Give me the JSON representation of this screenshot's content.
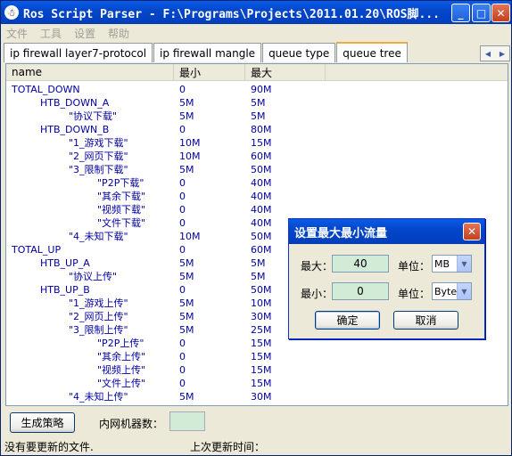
{
  "window": {
    "title": "Ros Script Parser - F:\\Programs\\Projects\\2011.01.20\\ROS脚..."
  },
  "menu": [
    "文件",
    "工具",
    "设置",
    "帮助"
  ],
  "tabs": [
    {
      "label": "ip firewall layer7-protocol",
      "active": false
    },
    {
      "label": "ip firewall mangle",
      "active": false
    },
    {
      "label": "queue type",
      "active": false
    },
    {
      "label": "queue tree",
      "active": true
    }
  ],
  "table": {
    "headers": [
      "name",
      "最小",
      "最大"
    ],
    "rows": [
      {
        "name": "TOTAL_DOWN",
        "level": 0,
        "min": "0",
        "max": "90M"
      },
      {
        "name": "HTB_DOWN_A",
        "level": 1,
        "min": "5M",
        "max": "5M"
      },
      {
        "name": "\"协议下载\"",
        "level": 2,
        "min": "5M",
        "max": "5M"
      },
      {
        "name": "HTB_DOWN_B",
        "level": 1,
        "min": "0",
        "max": "80M"
      },
      {
        "name": "\"1_游戏下载\"",
        "level": 2,
        "min": "10M",
        "max": "15M"
      },
      {
        "name": "\"2_网页下载\"",
        "level": 2,
        "min": "10M",
        "max": "60M"
      },
      {
        "name": "\"3_限制下载\"",
        "level": 2,
        "min": "5M",
        "max": "50M"
      },
      {
        "name": "\"P2P下载\"",
        "level": 3,
        "min": "0",
        "max": "40M"
      },
      {
        "name": "\"其余下载\"",
        "level": 3,
        "min": "0",
        "max": "40M"
      },
      {
        "name": "\"视频下载\"",
        "level": 3,
        "min": "0",
        "max": "40M"
      },
      {
        "name": "\"文件下载\"",
        "level": 3,
        "min": "0",
        "max": "40M"
      },
      {
        "name": "\"4_未知下载\"",
        "level": 2,
        "min": "10M",
        "max": "50M"
      },
      {
        "name": "TOTAL_UP",
        "level": 0,
        "min": "0",
        "max": "60M"
      },
      {
        "name": "HTB_UP_A",
        "level": 1,
        "min": "5M",
        "max": "5M"
      },
      {
        "name": "\"协议上传\"",
        "level": 2,
        "min": "5M",
        "max": "5M"
      },
      {
        "name": "HTB_UP_B",
        "level": 1,
        "min": "0",
        "max": "50M"
      },
      {
        "name": "\"1_游戏上传\"",
        "level": 2,
        "min": "5M",
        "max": "10M"
      },
      {
        "name": "\"2_网页上传\"",
        "level": 2,
        "min": "5M",
        "max": "30M"
      },
      {
        "name": "\"3_限制上传\"",
        "level": 2,
        "min": "5M",
        "max": "25M"
      },
      {
        "name": "\"P2P上传\"",
        "level": 3,
        "min": "0",
        "max": "15M"
      },
      {
        "name": "\"其余上传\"",
        "level": 3,
        "min": "0",
        "max": "15M"
      },
      {
        "name": "\"视频上传\"",
        "level": 3,
        "min": "0",
        "max": "15M"
      },
      {
        "name": "\"文件上传\"",
        "level": 3,
        "min": "0",
        "max": "15M"
      },
      {
        "name": "\"4_未知上传\"",
        "level": 2,
        "min": "5M",
        "max": "30M"
      }
    ]
  },
  "bottom": {
    "generate_label": "生成策略",
    "machine_count_label": "内网机器数：",
    "machine_count_value": "",
    "status_left": "没有要更新的文件.",
    "status_right": "上次更新时间："
  },
  "dialog": {
    "title": "设置最大最小流量",
    "max_label": "最大：",
    "max_value": "40",
    "min_label": "最小：",
    "min_value": "0",
    "unit_label_max": "单位：",
    "unit_max": "MB",
    "unit_label_min": "单位：",
    "unit_min": "Byte",
    "ok_label": "确定",
    "cancel_label": "取消"
  },
  "colors": {
    "title_blue": "#0447c9",
    "row_text": "#0000a0",
    "field_green": "#d2ebd7",
    "active_tab_accent": "#f7a83f"
  }
}
